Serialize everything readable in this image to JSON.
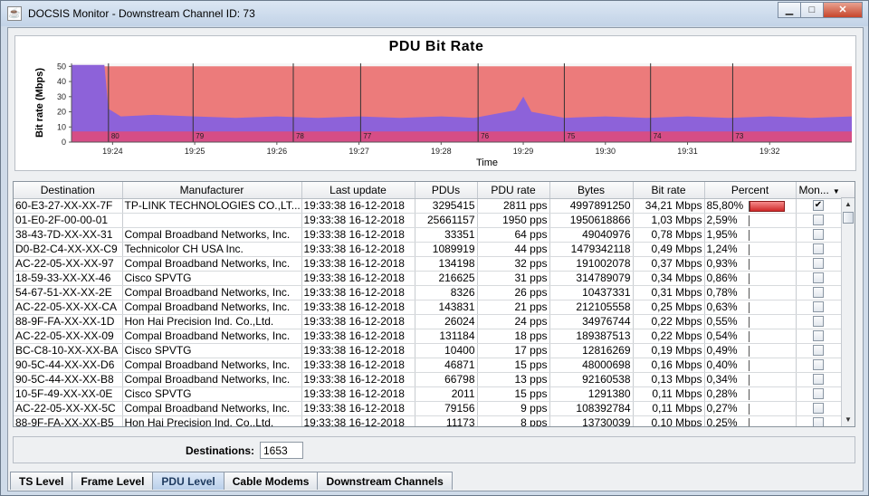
{
  "window": {
    "title": "DOCSIS Monitor - Downstream Channel ID: 73",
    "buttons": [
      "minimize",
      "maximize",
      "close"
    ]
  },
  "chart_data": {
    "type": "area",
    "title": "PDU Bit Rate",
    "xlabel": "Time",
    "ylabel": "Bit rate (Mbps)",
    "ylim": [
      0,
      52
    ],
    "y_ticks": [
      "0",
      "10",
      "20",
      "30",
      "40",
      "50"
    ],
    "x_ticks": [
      "19:24",
      "19:25",
      "19:26",
      "19:27",
      "19:28",
      "19:29",
      "19:30",
      "19:31",
      "19:32"
    ],
    "x_minutes": [
      24,
      25,
      26,
      27,
      28,
      29,
      30,
      31,
      32
    ],
    "xlim_minutes": [
      23.5,
      33.0
    ],
    "grid": false,
    "markers": [
      {
        "label": "80",
        "minute": 23.95
      },
      {
        "label": "79",
        "minute": 24.98
      },
      {
        "label": "78",
        "minute": 26.2
      },
      {
        "label": "77",
        "minute": 27.02
      },
      {
        "label": "76",
        "minute": 28.45
      },
      {
        "label": "75",
        "minute": 29.5
      },
      {
        "label": "74",
        "minute": 30.55
      },
      {
        "label": "73",
        "minute": 31.55
      }
    ],
    "series": [
      {
        "color": "#ec7b7b",
        "values_desc": "total bit rate",
        "points": [
          [
            23.5,
            50
          ],
          [
            33.0,
            50
          ]
        ]
      },
      {
        "color": "#8d62d9",
        "points": [
          [
            23.5,
            51
          ],
          [
            23.9,
            51
          ],
          [
            23.95,
            22
          ],
          [
            24.1,
            17
          ],
          [
            24.5,
            18
          ],
          [
            25.0,
            17
          ],
          [
            25.5,
            16
          ],
          [
            26.0,
            17
          ],
          [
            26.5,
            16
          ],
          [
            27.0,
            17
          ],
          [
            27.5,
            16
          ],
          [
            28.0,
            17
          ],
          [
            28.4,
            16
          ],
          [
            28.9,
            21
          ],
          [
            29.0,
            30
          ],
          [
            29.1,
            20
          ],
          [
            29.5,
            16
          ],
          [
            30.0,
            17
          ],
          [
            30.5,
            16
          ],
          [
            31.0,
            17
          ],
          [
            31.5,
            16
          ],
          [
            32.0,
            17
          ],
          [
            32.5,
            16
          ],
          [
            33.0,
            17
          ]
        ]
      },
      {
        "color": "#d64d86",
        "points": [
          [
            23.5,
            7
          ],
          [
            33.0,
            7
          ]
        ]
      }
    ]
  },
  "table": {
    "columns": [
      "Destination",
      "Manufacturer",
      "Last update",
      "PDUs",
      "PDU rate",
      "Bytes",
      "Bit rate",
      "Percent",
      "Mon..."
    ],
    "rows": [
      {
        "destination": "60-E3-27-XX-XX-7F",
        "manufacturer": "TP-LINK TECHNOLOGIES CO.,LT...",
        "last_update": "19:33:38  16-12-2018",
        "pdus": "3295415",
        "pdu_rate": "2811 pps",
        "bytes": "4997891250",
        "bit_rate": "34,21 Mbps",
        "percent": "85,80%",
        "percent_value": 85.8,
        "monitored": true
      },
      {
        "destination": "01-E0-2F-00-00-01",
        "manufacturer": "",
        "last_update": "19:33:38  16-12-2018",
        "pdus": "25661157",
        "pdu_rate": "1950 pps",
        "bytes": "1950618866",
        "bit_rate": "1,03 Mbps",
        "percent": "2,59%",
        "percent_value": 2.59,
        "monitored": false
      },
      {
        "destination": "38-43-7D-XX-XX-31",
        "manufacturer": "Compal Broadband Networks, Inc.",
        "last_update": "19:33:38  16-12-2018",
        "pdus": "33351",
        "pdu_rate": "64 pps",
        "bytes": "49040976",
        "bit_rate": "0,78 Mbps",
        "percent": "1,95%",
        "percent_value": 1.95,
        "monitored": false
      },
      {
        "destination": "D0-B2-C4-XX-XX-C9",
        "manufacturer": "Technicolor CH USA Inc.",
        "last_update": "19:33:38  16-12-2018",
        "pdus": "1089919",
        "pdu_rate": "44 pps",
        "bytes": "1479342118",
        "bit_rate": "0,49 Mbps",
        "percent": "1,24%",
        "percent_value": 1.24,
        "monitored": false
      },
      {
        "destination": "AC-22-05-XX-XX-97",
        "manufacturer": "Compal Broadband Networks, Inc.",
        "last_update": "19:33:38  16-12-2018",
        "pdus": "134198",
        "pdu_rate": "32 pps",
        "bytes": "191002078",
        "bit_rate": "0,37 Mbps",
        "percent": "0,93%",
        "percent_value": 0.93,
        "monitored": false
      },
      {
        "destination": "18-59-33-XX-XX-46",
        "manufacturer": "Cisco SPVTG",
        "last_update": "19:33:38  16-12-2018",
        "pdus": "216625",
        "pdu_rate": "31 pps",
        "bytes": "314789079",
        "bit_rate": "0,34 Mbps",
        "percent": "0,86%",
        "percent_value": 0.86,
        "monitored": false
      },
      {
        "destination": "54-67-51-XX-XX-2E",
        "manufacturer": "Compal Broadband Networks, Inc.",
        "last_update": "19:33:38  16-12-2018",
        "pdus": "8326",
        "pdu_rate": "26 pps",
        "bytes": "10437331",
        "bit_rate": "0,31 Mbps",
        "percent": "0,78%",
        "percent_value": 0.78,
        "monitored": false
      },
      {
        "destination": "AC-22-05-XX-XX-CA",
        "manufacturer": "Compal Broadband Networks, Inc.",
        "last_update": "19:33:38  16-12-2018",
        "pdus": "143831",
        "pdu_rate": "21 pps",
        "bytes": "212105558",
        "bit_rate": "0,25 Mbps",
        "percent": "0,63%",
        "percent_value": 0.63,
        "monitored": false
      },
      {
        "destination": "88-9F-FA-XX-XX-1D",
        "manufacturer": "Hon Hai Precision Ind. Co.,Ltd.",
        "last_update": "19:33:38  16-12-2018",
        "pdus": "26024",
        "pdu_rate": "24 pps",
        "bytes": "34976744",
        "bit_rate": "0,22 Mbps",
        "percent": "0,55%",
        "percent_value": 0.55,
        "monitored": false
      },
      {
        "destination": "AC-22-05-XX-XX-09",
        "manufacturer": "Compal Broadband Networks, Inc.",
        "last_update": "19:33:38  16-12-2018",
        "pdus": "131184",
        "pdu_rate": "18 pps",
        "bytes": "189387513",
        "bit_rate": "0,22 Mbps",
        "percent": "0,54%",
        "percent_value": 0.54,
        "monitored": false
      },
      {
        "destination": "BC-C8-10-XX-XX-BA",
        "manufacturer": "Cisco SPVTG",
        "last_update": "19:33:38  16-12-2018",
        "pdus": "10400",
        "pdu_rate": "17 pps",
        "bytes": "12816269",
        "bit_rate": "0,19 Mbps",
        "percent": "0,49%",
        "percent_value": 0.49,
        "monitored": false
      },
      {
        "destination": "90-5C-44-XX-XX-D6",
        "manufacturer": "Compal Broadband Networks, Inc.",
        "last_update": "19:33:38  16-12-2018",
        "pdus": "46871",
        "pdu_rate": "15 pps",
        "bytes": "48000698",
        "bit_rate": "0,16 Mbps",
        "percent": "0,40%",
        "percent_value": 0.4,
        "monitored": false
      },
      {
        "destination": "90-5C-44-XX-XX-B8",
        "manufacturer": "Compal Broadband Networks, Inc.",
        "last_update": "19:33:38  16-12-2018",
        "pdus": "66798",
        "pdu_rate": "13 pps",
        "bytes": "92160538",
        "bit_rate": "0,13 Mbps",
        "percent": "0,34%",
        "percent_value": 0.34,
        "monitored": false
      },
      {
        "destination": "10-5F-49-XX-XX-0E",
        "manufacturer": "Cisco SPVTG",
        "last_update": "19:33:38  16-12-2018",
        "pdus": "2011",
        "pdu_rate": "15 pps",
        "bytes": "1291380",
        "bit_rate": "0,11 Mbps",
        "percent": "0,28%",
        "percent_value": 0.28,
        "monitored": false
      },
      {
        "destination": "AC-22-05-XX-XX-5C",
        "manufacturer": "Compal Broadband Networks, Inc.",
        "last_update": "19:33:38  16-12-2018",
        "pdus": "79156",
        "pdu_rate": "9 pps",
        "bytes": "108392784",
        "bit_rate": "0,11 Mbps",
        "percent": "0,27%",
        "percent_value": 0.27,
        "monitored": false
      },
      {
        "destination": "88-9F-FA-XX-XX-B5",
        "manufacturer": "Hon Hai Precision Ind. Co.,Ltd.",
        "last_update": "19:33:38  16-12-2018",
        "pdus": "11173",
        "pdu_rate": "8 pps",
        "bytes": "13730039",
        "bit_rate": "0,10 Mbps",
        "percent": "0,25%",
        "percent_value": 0.25,
        "monitored": false
      }
    ]
  },
  "destinations": {
    "label": "Destinations:",
    "value": "1653"
  },
  "tabs": [
    {
      "label": "TS Level",
      "active": false
    },
    {
      "label": "Frame Level",
      "active": false
    },
    {
      "label": "PDU Level",
      "active": true
    },
    {
      "label": "Cable Modems",
      "active": false
    },
    {
      "label": "Downstream Channels",
      "active": false
    }
  ]
}
